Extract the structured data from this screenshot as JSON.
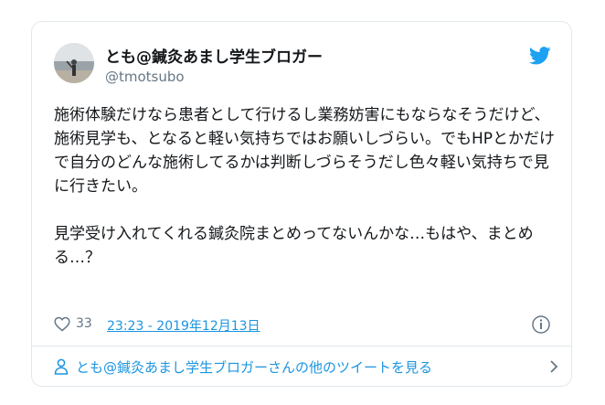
{
  "tweet": {
    "author": {
      "display_name": "とも@鍼灸あまし学生ブロガー",
      "handle": "@tmotsubo"
    },
    "text": "施術体験だけなら患者として行けるし業務妨害にもならなそうだけど、\n施術見学も、となると軽い気持ちではお願いしづらい。でもHPとかだけで自分のどんな施術してるかは判断しづらそうだし色々軽い気持ちで見に行きたい。\n\n見学受け入れてくれる鍼灸院まとめってないんかな…もはや、まとめる…？",
    "like_count": "33",
    "timestamp": "23:23 - 2019年12月13日",
    "footer_link": "とも@鍼灸あまし学生ブロガーさんの他のツイートを見る"
  },
  "icons": {
    "brand": "twitter-bird-icon",
    "like": "heart-icon",
    "info": "info-icon",
    "person": "person-icon",
    "chevron": "chevron-right-icon"
  },
  "colors": {
    "link_blue": "#1b95e0",
    "twitter_blue": "#1da1f2",
    "secondary_text": "#657786",
    "border": "#e1e8ed"
  }
}
